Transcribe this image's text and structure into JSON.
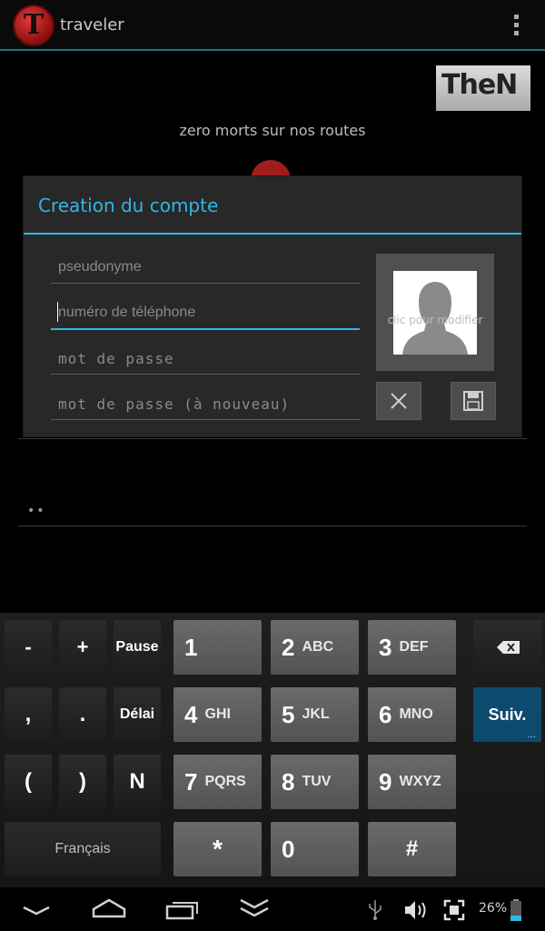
{
  "action_bar": {
    "logo_letter": "T",
    "title": "traveler",
    "overflow_icon": "overflow-menu-icon"
  },
  "background": {
    "banner_text": "TheN",
    "tagline": "zero morts sur nos routes",
    "password_mask": "••"
  },
  "dialog": {
    "title": "Creation du compte",
    "fields": [
      {
        "placeholder": "pseudonyme",
        "value": ""
      },
      {
        "placeholder": "numéro de téléphone",
        "value": ""
      },
      {
        "placeholder": "mot de passe",
        "value": ""
      },
      {
        "placeholder": "mot de passe (à nouveau)",
        "value": ""
      }
    ],
    "photo_caption": "clic pour modifier",
    "photo_icon": "avatar-placeholder-icon",
    "cancel_icon": "close-icon",
    "save_icon": "save-icon"
  },
  "keyboard": {
    "minus": "-",
    "plus": "+",
    "pause": "Pause",
    "comma": ",",
    "period": ".",
    "wait": "Délai",
    "open_paren": "(",
    "close_paren": ")",
    "n": "N",
    "language": "Français",
    "keys": [
      {
        "digit": "1",
        "letters": ""
      },
      {
        "digit": "2",
        "letters": "ABC"
      },
      {
        "digit": "3",
        "letters": "DEF"
      },
      {
        "digit": "4",
        "letters": "GHI"
      },
      {
        "digit": "5",
        "letters": "JKL"
      },
      {
        "digit": "6",
        "letters": "MNO"
      },
      {
        "digit": "7",
        "letters": "PQRS"
      },
      {
        "digit": "8",
        "letters": "TUV"
      },
      {
        "digit": "9",
        "letters": "WXYZ"
      },
      {
        "digit": "*",
        "letters": ""
      },
      {
        "digit": "0",
        "letters": ""
      },
      {
        "digit": "#",
        "letters": ""
      }
    ],
    "next_label": "Suiv.",
    "next_dots": "...",
    "backspace_icon": "backspace-icon"
  },
  "navbar": {
    "back_icon": "back-icon",
    "home_icon": "home-icon",
    "recents_icon": "recents-icon",
    "hide_keyboard_icon": "hide-keyboard-icon",
    "usb_icon": "usb-icon",
    "volume_icon": "volume-icon",
    "screenshot_icon": "screenshot-icon",
    "battery_percent": "26%",
    "battery_level": 0.26
  },
  "colors": {
    "accent": "#33b5e5",
    "dialog_bg": "#282828",
    "next_key": "#0d4a6e"
  }
}
